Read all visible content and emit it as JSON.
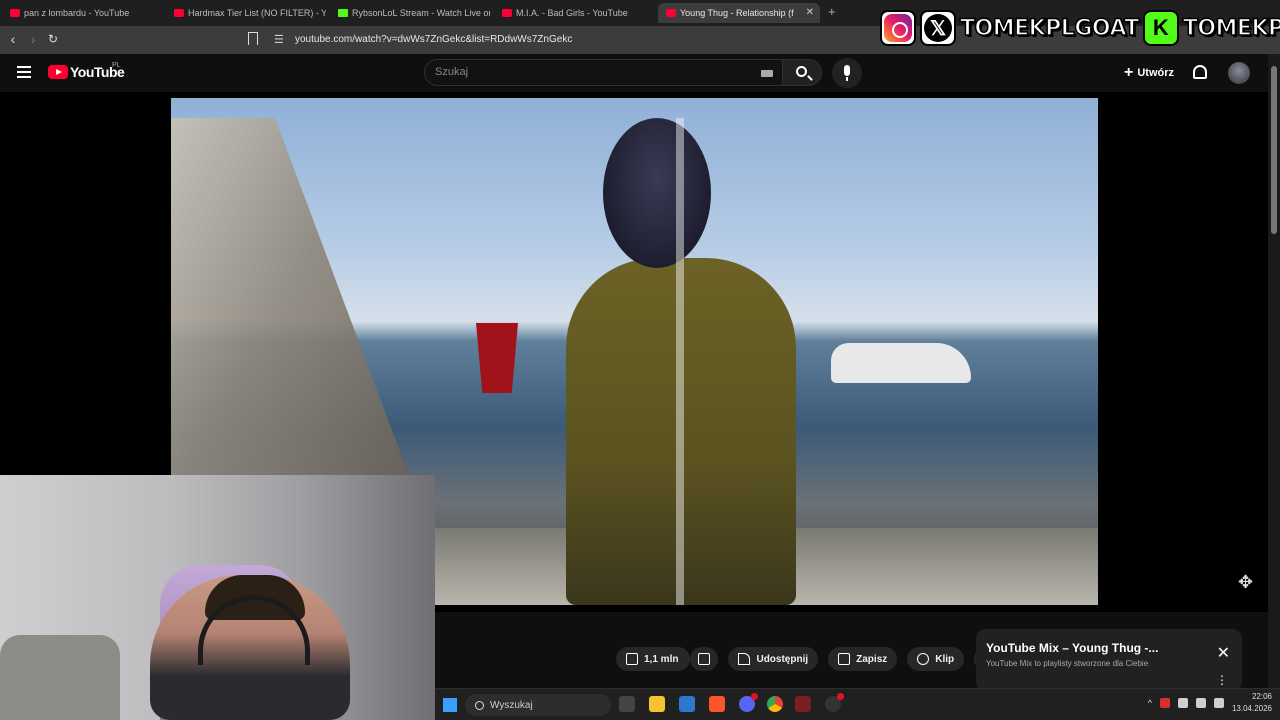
{
  "browser": {
    "tabs": [
      {
        "label": "pan z lombardu - YouTube",
        "type": "youtube",
        "active": false
      },
      {
        "label": "Hardmax Tier List (NO FILTER) - YouTube",
        "type": "youtube",
        "active": false
      },
      {
        "label": "RybsonLoL Stream - Watch Live on Kick",
        "type": "kick",
        "active": false
      },
      {
        "label": "M.I.A. - Bad Girls - YouTube",
        "type": "youtube",
        "active": false
      },
      {
        "label": "Young Thug - Relationship (f",
        "type": "youtube",
        "active": true
      }
    ],
    "new_tab": "+",
    "close_tab": "✕",
    "url": "youtube.com/watch?v=dwWs7ZnGekc&list=RDdwWs7ZnGekc"
  },
  "overlay": {
    "handle_primary": "TOMEKPLGOAT",
    "handle_secondary": "TOMEKPL",
    "x_glyph": "𝕏",
    "kick_glyph": "K"
  },
  "youtube": {
    "logo_text": "YouTube",
    "region": "PL",
    "search_placeholder": "Szukaj",
    "create_label": "Utwórz",
    "create_glyph": "+"
  },
  "actions": {
    "likes": "1,1 mln",
    "share": "Udostępnij",
    "save": "Zapisz",
    "clip": "Klip",
    "more": "•••"
  },
  "mix": {
    "title": "YouTube Mix – Young Thug -...",
    "subtitle": "YouTube Mix to playlisty stworzone dla Ciebie",
    "close": "✕",
    "menu": "⋮"
  },
  "taskbar": {
    "search_placeholder": "Wyszukaj",
    "time": "22:06",
    "date": "13.04.2026",
    "tray_chevron": "^"
  },
  "colors": {
    "youtube_red": "#ff0033",
    "kick_green": "#53fc18",
    "background": "#0f0f0f"
  }
}
